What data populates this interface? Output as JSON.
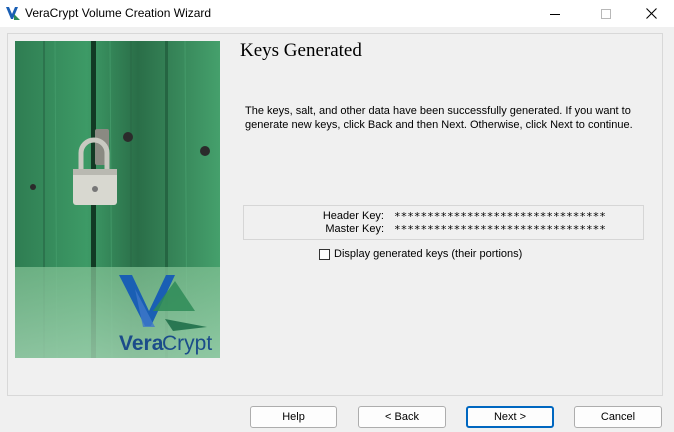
{
  "window": {
    "title": "VeraCrypt Volume Creation Wizard",
    "minimize_glyph": "—",
    "maximize_glyph": "☐",
    "close_glyph": "✕"
  },
  "brand": {
    "logo_text_vera": "Vera",
    "logo_text_crypt": "Crypt",
    "colors": {
      "logo_blue": "#1a5fb4",
      "logo_teal": "#2e8b57",
      "panel_green": "#3e8e5f"
    }
  },
  "page": {
    "title": "Keys Generated",
    "info": "The keys, salt, and other data have been successfully generated. If you want to generate new keys, click Back and then Next. Otherwise, click Next to continue."
  },
  "keys": {
    "header_label": "Header Key:",
    "header_value": "********************************",
    "master_label": "Master Key:",
    "master_value": "********************************"
  },
  "options": {
    "display_keys_label": "Display generated keys (their portions)",
    "display_keys_checked": false
  },
  "buttons": {
    "help": "Help",
    "back": "< Back",
    "next": "Next >",
    "cancel": "Cancel"
  },
  "icons": {
    "app": "veracrypt-logo-icon",
    "side": "padlock-door-image"
  }
}
